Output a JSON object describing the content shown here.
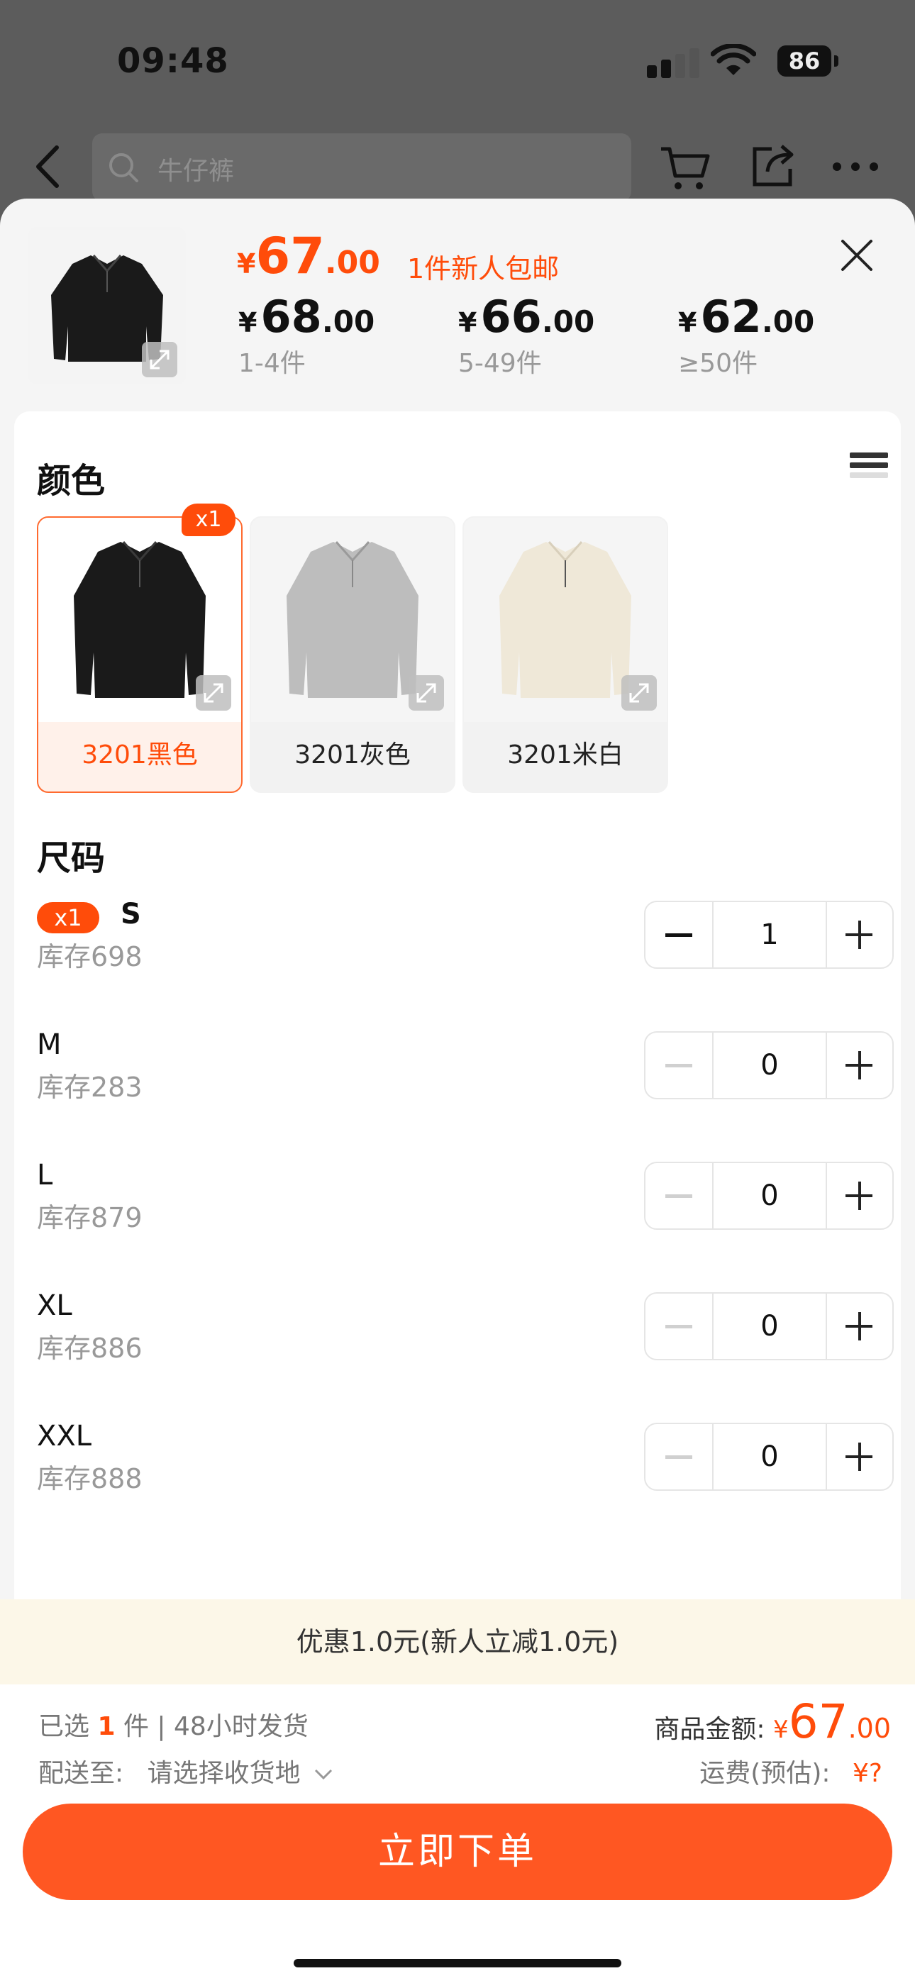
{
  "status_bar": {
    "time": "09:48",
    "battery": "86"
  },
  "header": {
    "search_placeholder": "牛仔裤"
  },
  "product": {
    "price": {
      "currency": "¥",
      "integer": "67",
      "decimal": ".00"
    },
    "promo_text": "1件新人包邮",
    "tiers": [
      {
        "currency": "¥",
        "integer": "68",
        "decimal": ".00",
        "range": "1-4件"
      },
      {
        "currency": "¥",
        "integer": "66",
        "decimal": ".00",
        "range": "5-49件"
      },
      {
        "currency": "¥",
        "integer": "62",
        "decimal": ".00",
        "range": "≥50件"
      }
    ]
  },
  "color_section": {
    "title": "颜色",
    "options": [
      {
        "label": "3201黑色",
        "badge": "x1",
        "selected": true,
        "color": "#1a1a1a"
      },
      {
        "label": "3201灰色",
        "badge": "",
        "selected": false,
        "color": "#bdbdbd"
      },
      {
        "label": "3201米白",
        "badge": "",
        "selected": false,
        "color": "#efe8d8"
      }
    ]
  },
  "size_section": {
    "title": "尺码",
    "sizes": [
      {
        "name": "S",
        "stock": "库存698",
        "qty": "1",
        "badge": "x1"
      },
      {
        "name": "M",
        "stock": "库存283",
        "qty": "0",
        "badge": ""
      },
      {
        "name": "L",
        "stock": "库存879",
        "qty": "0",
        "badge": ""
      },
      {
        "name": "XL",
        "stock": "库存886",
        "qty": "0",
        "badge": ""
      },
      {
        "name": "XXL",
        "stock": "库存888",
        "qty": "0",
        "badge": ""
      }
    ]
  },
  "promo_banner": "优惠1.0元(新人立减1.0元)",
  "footer": {
    "selected_prefix": "已选",
    "selected_count": "1",
    "selected_suffix": "件 | 48小时发货",
    "ship_label": "配送至:",
    "ship_value": "请选择收货地",
    "amount_label": "商品金额:",
    "amount_currency": "¥",
    "amount_integer": "67",
    "amount_decimal": ".00",
    "freight_label": "运费(预估):",
    "freight_value": "¥?",
    "order_button": "立即下单"
  },
  "colors": {
    "accent": "#ff4c0a",
    "button": "#ff5722"
  }
}
